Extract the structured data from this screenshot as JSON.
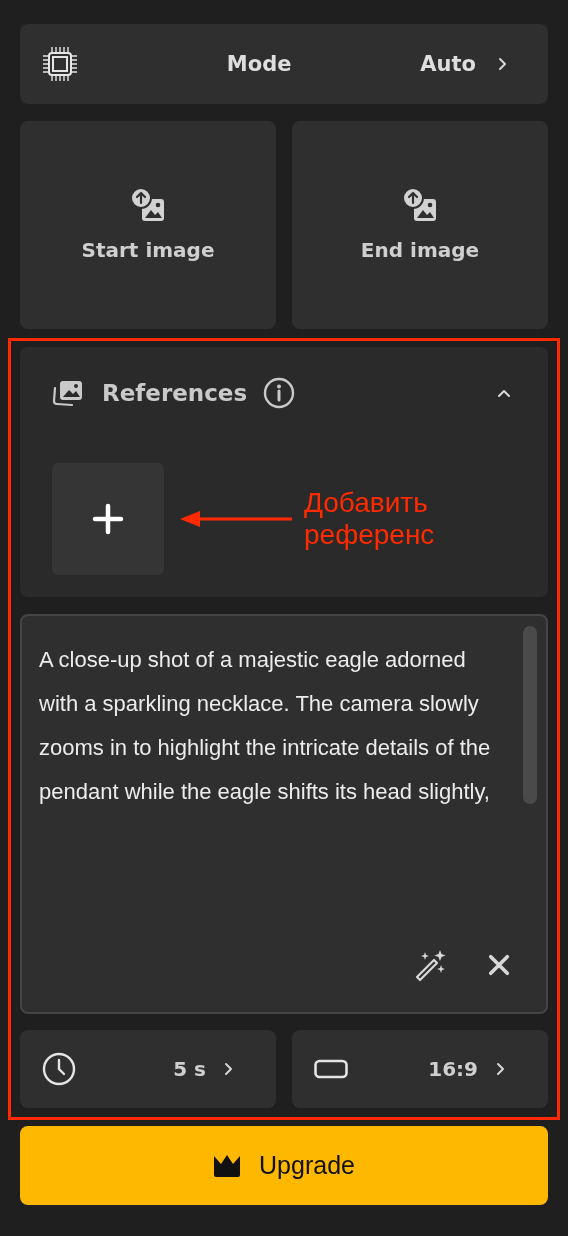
{
  "mode": {
    "label": "Mode",
    "value": "Auto"
  },
  "image_slots": [
    {
      "label": "Start image"
    },
    {
      "label": "End image"
    }
  ],
  "references": {
    "title": "References",
    "expanded": true
  },
  "annotation": {
    "text": "Добавить референс"
  },
  "prompt": {
    "value": "A close-up shot of a majestic eagle adorned with a sparkling necklace. The camera slowly zooms in to highlight the intricate details of the pendant while the eagle shifts its head slightly,"
  },
  "settings": [
    {
      "kind": "duration",
      "value": "5 s"
    },
    {
      "kind": "aspect",
      "value": "16:9"
    }
  ],
  "upgrade": {
    "label": "Upgrade"
  }
}
